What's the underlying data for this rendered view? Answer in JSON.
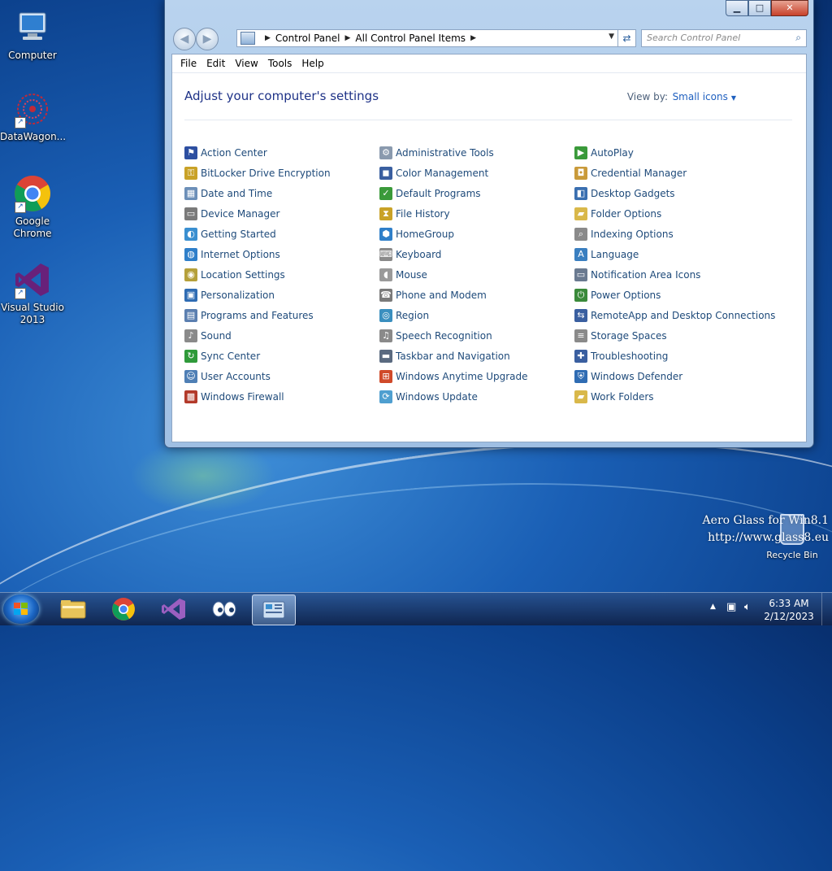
{
  "desktop": {
    "icons": [
      {
        "label": "Computer"
      },
      {
        "label": "DataWagon..."
      },
      {
        "label": "Google Chrome"
      },
      {
        "label": "Visual Studio 2013"
      }
    ],
    "recycle_bin": "Recycle Bin",
    "watermark": [
      "Aero Glass for Win8.1",
      "http://www.glass8.eu"
    ]
  },
  "window": {
    "caption": {
      "minimize": "▁",
      "maximize": "□",
      "close": "✕"
    },
    "address": {
      "segments": [
        "Control Panel",
        "All Control Panel Items"
      ]
    },
    "search_placeholder": "Search Control Panel",
    "menu": [
      "File",
      "Edit",
      "View",
      "Tools",
      "Help"
    ],
    "heading": "Adjust your computer's settings",
    "view_by_label": "View by:",
    "view_by_value": "Small icons",
    "columns": [
      [
        {
          "label": "Action Center",
          "color": "#2d4fa1",
          "icon": "flag-icon"
        },
        {
          "label": "BitLocker Drive Encryption",
          "color": "#c9a227",
          "icon": "key-icon"
        },
        {
          "label": "Date and Time",
          "color": "#6c8fb8",
          "icon": "calendar-icon"
        },
        {
          "label": "Device Manager",
          "color": "#7a7a7a",
          "icon": "device-icon"
        },
        {
          "label": "Getting Started",
          "color": "#3a8fd0",
          "icon": "start-icon"
        },
        {
          "label": "Internet Options",
          "color": "#2f7fc9",
          "icon": "globe-icon"
        },
        {
          "label": "Location Settings",
          "color": "#b5a03a",
          "icon": "location-icon"
        },
        {
          "label": "Personalization",
          "color": "#2f6cb3",
          "icon": "monitor-icon"
        },
        {
          "label": "Programs and Features",
          "color": "#5b7fb0",
          "icon": "programs-icon"
        },
        {
          "label": "Sound",
          "color": "#8a8a8a",
          "icon": "speaker-icon"
        },
        {
          "label": "Sync Center",
          "color": "#2f9a3a",
          "icon": "sync-icon"
        },
        {
          "label": "User Accounts",
          "color": "#4f7fb5",
          "icon": "users-icon"
        },
        {
          "label": "Windows Firewall",
          "color": "#b33a2a",
          "icon": "firewall-icon"
        }
      ],
      [
        {
          "label": "Administrative Tools",
          "color": "#8a9aae",
          "icon": "tools-icon"
        },
        {
          "label": "Color Management",
          "color": "#3a5fa0",
          "icon": "color-icon"
        },
        {
          "label": "Default Programs",
          "color": "#3a9a3a",
          "icon": "default-icon"
        },
        {
          "label": "File History",
          "color": "#c9a227",
          "icon": "history-icon"
        },
        {
          "label": "HomeGroup",
          "color": "#2f7fc9",
          "icon": "homegroup-icon"
        },
        {
          "label": "Keyboard",
          "color": "#8a8a8a",
          "icon": "keyboard-icon"
        },
        {
          "label": "Mouse",
          "color": "#9a9a9a",
          "icon": "mouse-icon"
        },
        {
          "label": "Phone and Modem",
          "color": "#7a7a7a",
          "icon": "phone-icon"
        },
        {
          "label": "Region",
          "color": "#3a8fbf",
          "icon": "region-icon"
        },
        {
          "label": "Speech Recognition",
          "color": "#8a8a8a",
          "icon": "mic-icon"
        },
        {
          "label": "Taskbar and Navigation",
          "color": "#5a6a80",
          "icon": "taskbar-icon"
        },
        {
          "label": "Windows Anytime Upgrade",
          "color": "#d04a2a",
          "icon": "windows-icon"
        },
        {
          "label": "Windows Update",
          "color": "#4f9fd0",
          "icon": "update-icon"
        }
      ],
      [
        {
          "label": "AutoPlay",
          "color": "#3a9a3a",
          "icon": "autoplay-icon"
        },
        {
          "label": "Credential Manager",
          "color": "#c99a3a",
          "icon": "credential-icon"
        },
        {
          "label": "Desktop Gadgets",
          "color": "#3a6fb0",
          "icon": "gadgets-icon"
        },
        {
          "label": "Folder Options",
          "color": "#d9b84a",
          "icon": "folder-icon"
        },
        {
          "label": "Indexing Options",
          "color": "#8a8a8a",
          "icon": "index-icon"
        },
        {
          "label": "Language",
          "color": "#3a7fc0",
          "icon": "language-icon"
        },
        {
          "label": "Notification Area Icons",
          "color": "#6a7a90",
          "icon": "notify-icon"
        },
        {
          "label": "Power Options",
          "color": "#3a8a3a",
          "icon": "power-icon"
        },
        {
          "label": "RemoteApp and Desktop Connections",
          "color": "#3a5fa0",
          "icon": "remote-icon"
        },
        {
          "label": "Storage Spaces",
          "color": "#8a8a8a",
          "icon": "storage-icon"
        },
        {
          "label": "Troubleshooting",
          "color": "#3a5fa0",
          "icon": "troubleshoot-icon"
        },
        {
          "label": "Windows Defender",
          "color": "#2f6cb3",
          "icon": "defender-icon"
        },
        {
          "label": "Work Folders",
          "color": "#d9b84a",
          "icon": "workfolders-icon"
        }
      ]
    ]
  },
  "taskbar": {
    "time": "6:33 AM",
    "date": "2/12/2023"
  }
}
